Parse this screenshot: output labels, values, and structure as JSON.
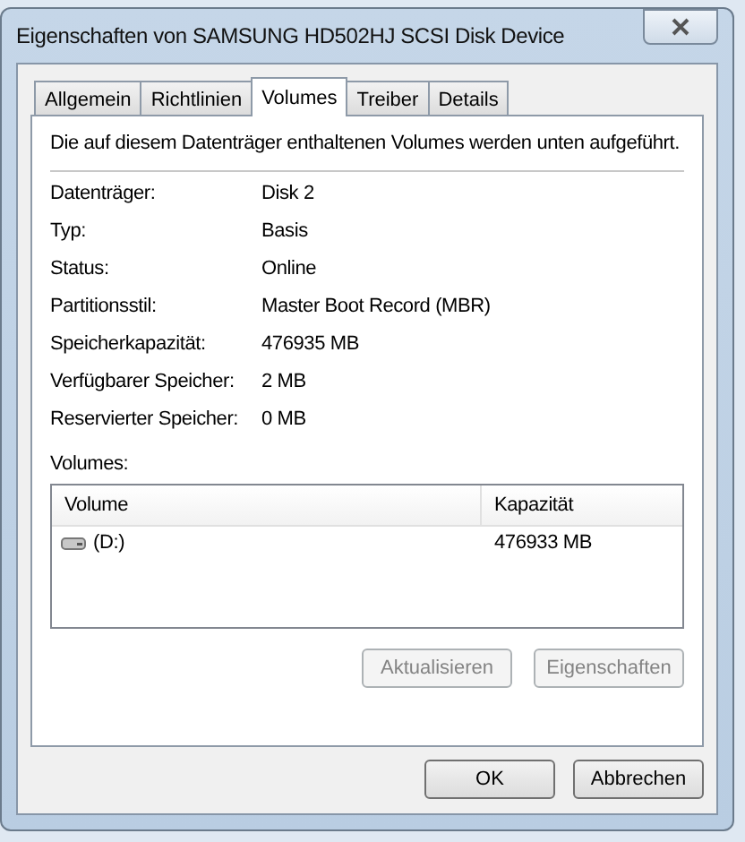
{
  "window": {
    "title": "Eigenschaften von SAMSUNG HD502HJ SCSI Disk Device"
  },
  "tabs": [
    {
      "label": "Allgemein",
      "selected": false
    },
    {
      "label": "Richtlinien",
      "selected": false
    },
    {
      "label": "Volumes",
      "selected": true
    },
    {
      "label": "Treiber",
      "selected": false
    },
    {
      "label": "Details",
      "selected": false
    }
  ],
  "description": "Die auf diesem Datenträger enthaltenen Volumes werden unten aufgeführt.",
  "properties": [
    {
      "label": "Datenträger:",
      "value": "Disk 2"
    },
    {
      "label": "Typ:",
      "value": "Basis"
    },
    {
      "label": "Status:",
      "value": "Online"
    },
    {
      "label": "Partitionsstil:",
      "value": "Master Boot Record (MBR)"
    },
    {
      "label": "Speicherkapazität:",
      "value": "476935 MB"
    },
    {
      "label": "Verfügbarer Speicher:",
      "value": "2 MB"
    },
    {
      "label": "Reservierter Speicher:",
      "value": "0 MB"
    }
  ],
  "volumes": {
    "label": "Volumes:",
    "columns": [
      "Volume",
      "Kapazität"
    ],
    "rows": [
      {
        "volume": "(D:)",
        "capacity": "476933 MB"
      }
    ]
  },
  "panel_buttons": [
    {
      "label": "Aktualisieren",
      "disabled": true
    },
    {
      "label": "Eigenschaften",
      "disabled": true
    }
  ],
  "buttons": [
    {
      "label": "OK",
      "disabled": false
    },
    {
      "label": "Abbrechen",
      "disabled": false
    }
  ]
}
